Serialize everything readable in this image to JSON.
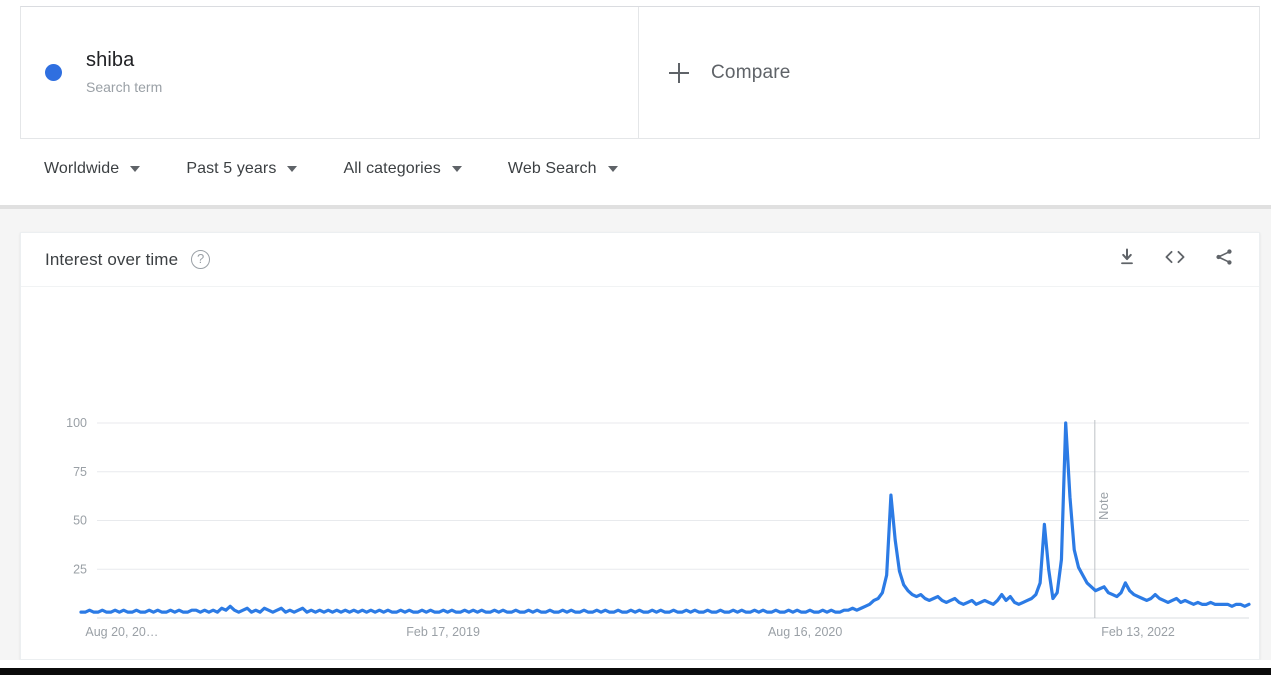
{
  "search_term": {
    "label": "shiba",
    "type_label": "Search term",
    "dot_color": "#2f6fe0"
  },
  "compare": {
    "label": "Compare",
    "icon": "plus-icon"
  },
  "filters": [
    {
      "label": "Worldwide",
      "name": "location"
    },
    {
      "label": "Past 5 years",
      "name": "time-range"
    },
    {
      "label": "All categories",
      "name": "category"
    },
    {
      "label": "Web Search",
      "name": "search-type"
    }
  ],
  "card": {
    "title": "Interest over time",
    "help_icon": "?",
    "actions": [
      {
        "name": "download-icon",
        "title": "Download"
      },
      {
        "name": "embed-icon",
        "title": "Embed"
      },
      {
        "name": "share-icon",
        "title": "Share"
      }
    ]
  },
  "chart_data": {
    "type": "line",
    "title": "Interest over time",
    "series_name": "shiba",
    "line_color": "#2c7be5",
    "xlabel": "",
    "ylabel": "",
    "ylim": [
      0,
      100
    ],
    "yticks": [
      25,
      50,
      75,
      100
    ],
    "grid": true,
    "legend_position": "none",
    "xticks": [
      "Aug 20, 20…",
      "Feb 17, 2019",
      "Aug 16, 2020",
      "Feb 13, 2022"
    ],
    "xtick_positions_pct": [
      3.5,
      31.0,
      62.0,
      90.5
    ],
    "annotations": [
      {
        "label": "Note",
        "x_pct": 86.8,
        "orientation": "vertical"
      }
    ],
    "x": [
      0,
      1,
      2,
      3,
      4,
      5,
      6,
      7,
      8,
      9,
      10,
      11,
      12,
      13,
      14,
      15,
      16,
      17,
      18,
      19,
      20,
      21,
      22,
      23,
      24,
      25,
      26,
      27,
      28,
      29,
      30,
      31,
      32,
      33,
      34,
      35,
      36,
      37,
      38,
      39,
      40,
      41,
      42,
      43,
      44,
      45,
      46,
      47,
      48,
      49,
      50,
      51,
      52,
      53,
      54,
      55,
      56,
      57,
      58,
      59,
      60,
      61,
      62,
      63,
      64,
      65,
      66,
      67,
      68,
      69,
      70,
      71,
      72,
      73,
      74,
      75,
      76,
      77,
      78,
      79,
      80,
      81,
      82,
      83,
      84,
      85,
      86,
      87,
      88,
      89,
      90,
      91,
      92,
      93,
      94,
      95,
      96,
      97,
      98,
      99,
      100,
      101,
      102,
      103,
      104,
      105,
      106,
      107,
      108,
      109,
      110,
      111,
      112,
      113,
      114,
      115,
      116,
      117,
      118,
      119,
      120,
      121,
      122,
      123,
      124,
      125,
      126,
      127,
      128,
      129,
      130,
      131,
      132,
      133,
      134,
      135,
      136,
      137,
      138,
      139,
      140,
      141,
      142,
      143,
      144,
      145,
      146,
      147,
      148,
      149,
      150,
      151,
      152,
      153,
      154,
      155,
      156,
      157,
      158,
      159,
      160,
      161,
      162,
      163,
      164,
      165,
      166,
      167,
      168,
      169,
      170,
      171,
      172,
      173,
      174,
      175,
      176,
      177,
      178,
      179,
      180,
      181,
      182,
      183,
      184,
      185,
      186,
      187,
      188,
      189,
      190,
      191,
      192,
      193,
      194,
      195,
      196,
      197,
      198,
      199,
      200,
      201,
      202,
      203,
      204,
      205,
      206,
      207,
      208,
      209,
      210,
      211,
      212,
      213,
      214,
      215,
      216,
      217,
      218,
      219,
      220,
      221,
      222,
      223,
      224,
      225,
      226,
      227,
      228,
      229,
      230,
      231,
      232,
      233,
      234,
      235,
      236,
      237,
      238,
      239,
      240,
      241,
      242,
      243,
      244,
      245,
      246,
      247,
      248,
      249,
      250,
      251,
      252,
      253,
      254,
      255,
      256,
      257,
      258,
      259
    ],
    "values": [
      3,
      3,
      4,
      3,
      3,
      4,
      3,
      3,
      4,
      3,
      4,
      3,
      3,
      4,
      3,
      3,
      4,
      3,
      4,
      3,
      3,
      4,
      3,
      4,
      3,
      3,
      4,
      4,
      3,
      4,
      3,
      4,
      3,
      5,
      4,
      6,
      4,
      3,
      4,
      5,
      3,
      4,
      3,
      5,
      4,
      3,
      4,
      5,
      3,
      4,
      3,
      4,
      5,
      3,
      4,
      3,
      4,
      3,
      4,
      3,
      4,
      3,
      4,
      3,
      4,
      3,
      4,
      3,
      4,
      3,
      4,
      3,
      4,
      3,
      3,
      4,
      3,
      4,
      3,
      3,
      4,
      3,
      4,
      3,
      3,
      4,
      3,
      4,
      3,
      3,
      4,
      3,
      4,
      3,
      4,
      3,
      3,
      4,
      3,
      4,
      3,
      3,
      4,
      3,
      3,
      4,
      3,
      4,
      3,
      3,
      4,
      3,
      3,
      4,
      3,
      4,
      3,
      3,
      4,
      3,
      3,
      4,
      3,
      4,
      3,
      3,
      4,
      3,
      3,
      4,
      3,
      4,
      3,
      3,
      4,
      3,
      4,
      3,
      3,
      4,
      3,
      3,
      4,
      3,
      4,
      3,
      3,
      4,
      3,
      3,
      4,
      3,
      3,
      4,
      3,
      4,
      3,
      3,
      4,
      3,
      4,
      3,
      3,
      4,
      3,
      3,
      4,
      3,
      4,
      3,
      3,
      4,
      3,
      3,
      4,
      3,
      4,
      3,
      3,
      4,
      4,
      5,
      4,
      5,
      6,
      7,
      9,
      10,
      13,
      22,
      63,
      40,
      24,
      17,
      14,
      12,
      11,
      12,
      10,
      9,
      10,
      11,
      9,
      8,
      9,
      10,
      8,
      7,
      8,
      9,
      7,
      8,
      9,
      8,
      7,
      9,
      12,
      9,
      11,
      8,
      7,
      8,
      9,
      10,
      12,
      18,
      48,
      25,
      10,
      13,
      30,
      100,
      62,
      35,
      26,
      22,
      18,
      16,
      14,
      15,
      16,
      13,
      12,
      11,
      13,
      18,
      14,
      12,
      11,
      10,
      9,
      10,
      12,
      10,
      9,
      8,
      9,
      10,
      8,
      9,
      8,
      7,
      8,
      7,
      7,
      8,
      7,
      7,
      7,
      7,
      6,
      7,
      7,
      6,
      7
    ]
  }
}
